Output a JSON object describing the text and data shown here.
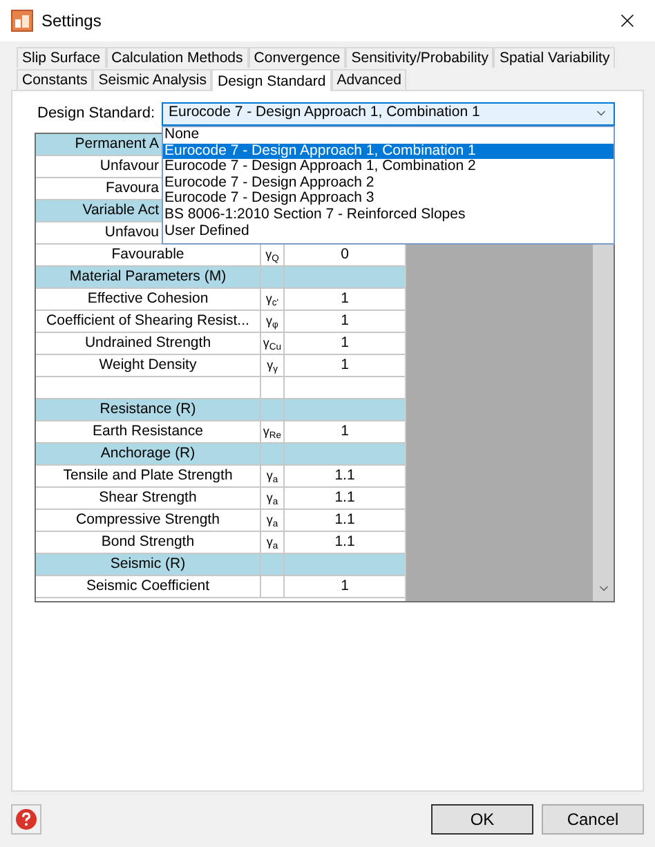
{
  "window": {
    "title": "Settings"
  },
  "tabs": [
    [
      {
        "label": "Slip Surface",
        "selected": false
      },
      {
        "label": "Calculation Methods",
        "selected": false
      },
      {
        "label": "Convergence",
        "selected": false
      },
      {
        "label": "Sensitivity/Probability",
        "selected": false
      },
      {
        "label": "Spatial Variability",
        "selected": false
      }
    ],
    [
      {
        "label": "Constants",
        "selected": false
      },
      {
        "label": "Seismic Analysis",
        "selected": false
      },
      {
        "label": "Design Standard",
        "selected": true
      },
      {
        "label": "Advanced",
        "selected": false
      }
    ]
  ],
  "design_standard": {
    "label": "Design Standard:",
    "value": "Eurocode 7 - Design Approach 1, Combination 1",
    "expanded": true,
    "options": [
      {
        "label": "None",
        "selected": false
      },
      {
        "label": "Eurocode 7 - Design Approach 1, Combination 1",
        "selected": true
      },
      {
        "label": "Eurocode 7 - Design Approach 1, Combination 2",
        "selected": false
      },
      {
        "label": "Eurocode 7 - Design Approach 2",
        "selected": false
      },
      {
        "label": "Eurocode 7 - Design Approach 3",
        "selected": false
      },
      {
        "label": "BS 8006-1:2010 Section 7 - Reinforced Slopes",
        "selected": false
      },
      {
        "label": "User Defined",
        "selected": false
      }
    ]
  },
  "table": {
    "rows": [
      {
        "kind": "header",
        "label": "Permanent A",
        "partly_covered": true
      },
      {
        "kind": "row",
        "label": "Unfavour",
        "partly_covered": true
      },
      {
        "kind": "row",
        "label": "Favoura",
        "partly_covered": true
      },
      {
        "kind": "header",
        "label": "Variable Act",
        "partly_covered": true
      },
      {
        "kind": "row",
        "label": "Unfavou",
        "partly_covered": true
      },
      {
        "kind": "row",
        "label": "Favourable",
        "symbol": "γ$_{Q}$",
        "value": "0",
        "partly_covered": false
      },
      {
        "kind": "header",
        "label": "Material Parameters (M)",
        "partly_covered": false
      },
      {
        "kind": "row",
        "label": "Effective Cohesion",
        "symbol": "γ$_{c'}$",
        "value": "1",
        "partly_covered": false
      },
      {
        "kind": "row",
        "label": "Coefficient of Shearing Resist...",
        "symbol": "γ$_{φ}$",
        "value": "1",
        "partly_covered": false
      },
      {
        "kind": "row",
        "label": "Undrained Strength",
        "symbol": "γ$_{Cu}$",
        "value": "1",
        "partly_covered": false
      },
      {
        "kind": "row",
        "label": "Weight Density",
        "symbol": "γ$_{γ}$",
        "value": "1",
        "partly_covered": false
      },
      {
        "kind": "blank"
      },
      {
        "kind": "header",
        "label": "Resistance (R)",
        "partly_covered": false
      },
      {
        "kind": "row",
        "label": "Earth Resistance",
        "symbol": "γ$_{Re}$",
        "value": "1",
        "partly_covered": false
      },
      {
        "kind": "header",
        "label": "Anchorage (R)",
        "partly_covered": false
      },
      {
        "kind": "row",
        "label": "Tensile and Plate Strength",
        "symbol": "γ$_{a}$",
        "value": "1.1",
        "partly_covered": false
      },
      {
        "kind": "row",
        "label": "Shear Strength",
        "symbol": "γ$_{a}$",
        "value": "1.1",
        "partly_covered": false
      },
      {
        "kind": "row",
        "label": "Compressive Strength",
        "symbol": "γ$_{a}$",
        "value": "1.1",
        "partly_covered": false
      },
      {
        "kind": "row",
        "label": "Bond Strength",
        "symbol": "γ$_{a}$",
        "value": "1.1",
        "partly_covered": false
      },
      {
        "kind": "header",
        "label": "Seismic (R)",
        "partly_covered": false
      },
      {
        "kind": "row",
        "label": "Seismic Coefficient",
        "value": "1",
        "partly_covered": false
      }
    ]
  },
  "buttons": [
    {
      "label": "OK",
      "kind": "default"
    },
    {
      "label": "Cancel",
      "kind": "normal"
    }
  ]
}
